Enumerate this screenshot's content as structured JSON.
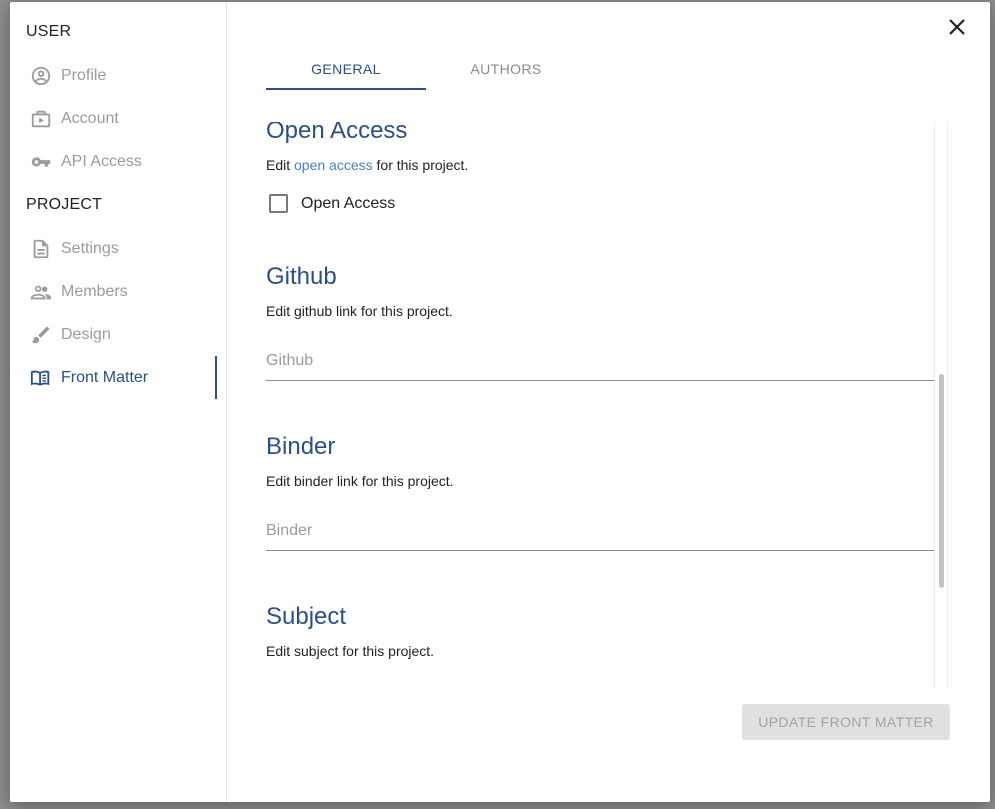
{
  "sidebar": {
    "user_title": "USER",
    "project_title": "PROJECT",
    "user_items": [
      {
        "label": "Profile",
        "icon": "account-circle-icon"
      },
      {
        "label": "Account",
        "icon": "briefcase-icon"
      },
      {
        "label": "API Access",
        "icon": "key-icon"
      }
    ],
    "project_items": [
      {
        "label": "Settings",
        "icon": "document-icon"
      },
      {
        "label": "Members",
        "icon": "people-icon"
      },
      {
        "label": "Design",
        "icon": "brush-icon"
      },
      {
        "label": "Front Matter",
        "icon": "book-icon",
        "active": true
      }
    ]
  },
  "tabs": [
    {
      "label": "GENERAL",
      "active": true
    },
    {
      "label": "AUTHORS",
      "active": false
    }
  ],
  "sections": {
    "open_access": {
      "title": "Open Access",
      "desc_prefix": "Edit ",
      "desc_link": "open access",
      "desc_suffix": " for this project.",
      "checkbox_label": "Open Access",
      "checked": false
    },
    "github": {
      "title": "Github",
      "desc": "Edit github link for this project.",
      "placeholder": "Github",
      "value": ""
    },
    "binder": {
      "title": "Binder",
      "desc": "Edit binder link for this project.",
      "placeholder": "Binder",
      "value": ""
    },
    "subject": {
      "title": "Subject",
      "desc": "Edit subject for this project."
    }
  },
  "update_button": "UPDATE FRONT MATTER",
  "colors": {
    "accent": "#2b4f86",
    "link": "#4a7fc1",
    "muted": "#9b9b9b",
    "disabled_bg": "#e0e0e0"
  }
}
